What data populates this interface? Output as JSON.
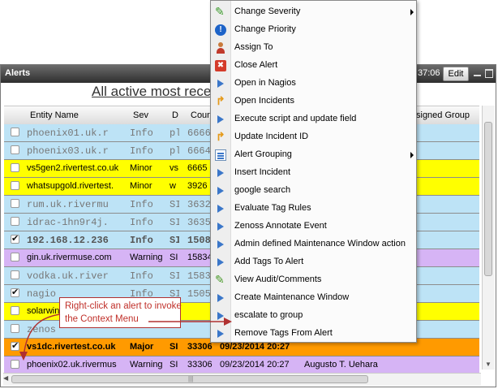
{
  "window": {
    "title": "Alerts",
    "time_fragment": "37:06",
    "edit_label": "Edit"
  },
  "heading": "All active most rece",
  "columns": {
    "entity": "Entity Name",
    "sev": "Sev",
    "d": "D",
    "count": "Count",
    "assigned": "signed Group"
  },
  "rows": [
    {
      "entity": "phoenix01.uk.r",
      "sev": "Info",
      "d": "pl",
      "count": "6666",
      "date": "",
      "assigned": "",
      "checked": false,
      "color": "#bde3f6",
      "style": "mono"
    },
    {
      "entity": "phoenix03.uk.r",
      "sev": "Info",
      "d": "pl",
      "count": "6664",
      "date": "",
      "assigned": "",
      "checked": false,
      "color": "#bde3f6",
      "style": "mono"
    },
    {
      "entity": "vs5gen2.rivertest.co.uk",
      "sev": "Minor",
      "d": "vs",
      "count": "6665",
      "date": "",
      "assigned": "",
      "checked": false,
      "color": "#ffff00",
      "style": "plain"
    },
    {
      "entity": "whatsupgold.rivertest.",
      "sev": "Minor",
      "d": "w",
      "count": "3926",
      "date": "",
      "assigned": "",
      "checked": false,
      "color": "#ffff00",
      "style": "plain"
    },
    {
      "entity": "rum.uk.rivermu",
      "sev": "Info",
      "d": "SI",
      "count": "3632",
      "date": "",
      "assigned": "",
      "checked": false,
      "color": "#bde3f6",
      "style": "mono"
    },
    {
      "entity": "idrac-1hn9r4j.",
      "sev": "Info",
      "d": "SI",
      "count": "3635",
      "date": "",
      "assigned": "",
      "checked": false,
      "color": "#bde3f6",
      "style": "mono"
    },
    {
      "entity": "192.168.12.236",
      "sev": "Info",
      "d": "SI",
      "count": "1508",
      "date": "",
      "assigned": "",
      "checked": true,
      "color": "#bde3f6",
      "style": "monob"
    },
    {
      "entity": "gin.uk.rivermuse.com",
      "sev": "Warning",
      "d": "SI",
      "count": "15834",
      "date": "",
      "assigned": "",
      "checked": false,
      "color": "#d6b4f5",
      "style": "plain"
    },
    {
      "entity": "vodka.uk.river",
      "sev": "Info",
      "d": "SI",
      "count": "1583",
      "date": "",
      "assigned": "",
      "checked": false,
      "color": "#bde3f6",
      "style": "mono"
    },
    {
      "entity": "nagio",
      "sev": "Info",
      "d": "SI",
      "count": "1505",
      "date": "",
      "assigned": "",
      "checked": true,
      "color": "#bde3f6",
      "style": "mono"
    },
    {
      "entity": "solarwin",
      "sev": "",
      "d": "",
      "count": "",
      "date": "",
      "assigned": "",
      "checked": false,
      "color": "#ffff00",
      "style": "plain"
    },
    {
      "entity": "zenos",
      "sev": "",
      "d": "",
      "count": "",
      "date": "",
      "assigned": "",
      "checked": false,
      "color": "#bde3f6",
      "style": "mono"
    },
    {
      "entity": "vs1dc.rivertest.co.uk",
      "sev": "Major",
      "d": "SI",
      "count": "33306",
      "date": "09/23/2014 20:27",
      "assigned": "",
      "checked": true,
      "color": "#ff9a00",
      "style": "bold"
    },
    {
      "entity": "phoenix02.uk.rivermus",
      "sev": "Warning",
      "d": "SI",
      "count": "33306",
      "date": "09/23/2014 20:27",
      "assigned": "Augusto T. Uehara",
      "checked": false,
      "color": "#d6b4f5",
      "style": "plain"
    }
  ],
  "menu": [
    {
      "label": "Change Severity",
      "icon": "pencil-icon",
      "submenu": true
    },
    {
      "label": "Change Priority",
      "icon": "info-icon",
      "submenu": false
    },
    {
      "label": "Assign To",
      "icon": "user-icon",
      "submenu": false
    },
    {
      "label": "Close Alert",
      "icon": "close-icon",
      "submenu": false
    },
    {
      "label": "Open in Nagios",
      "icon": "triangle-icon",
      "submenu": false
    },
    {
      "label": "Open Incidents",
      "icon": "up-arrow-icon",
      "submenu": false
    },
    {
      "label": "Execute script and update field",
      "icon": "triangle-icon",
      "submenu": false
    },
    {
      "label": "Update Incident ID",
      "icon": "up-arrow-icon",
      "submenu": false
    },
    {
      "label": "Alert Grouping",
      "icon": "group-icon",
      "submenu": true
    },
    {
      "label": "Insert Incident",
      "icon": "triangle-icon",
      "submenu": false
    },
    {
      "label": "google search",
      "icon": "triangle-icon",
      "submenu": false
    },
    {
      "label": "Evaluate Tag Rules",
      "icon": "triangle-icon",
      "submenu": false
    },
    {
      "label": "Zenoss Annotate Event",
      "icon": "triangle-icon",
      "submenu": false
    },
    {
      "label": "Admin defined Maintenance Window action",
      "icon": "triangle-icon",
      "submenu": false
    },
    {
      "label": "Add Tags To Alert",
      "icon": "triangle-icon",
      "submenu": false
    },
    {
      "label": "View Audit/Comments",
      "icon": "view-icon",
      "submenu": false
    },
    {
      "label": "Create Maintenance Window",
      "icon": "triangle-icon",
      "submenu": false
    },
    {
      "label": "escalate to group",
      "icon": "triangle-icon",
      "submenu": false
    },
    {
      "label": "Remove Tags From Alert",
      "icon": "triangle-icon",
      "submenu": false
    }
  ],
  "callout": {
    "line1": "Right-click an alert to invoke",
    "line2": "the Context Menu"
  }
}
